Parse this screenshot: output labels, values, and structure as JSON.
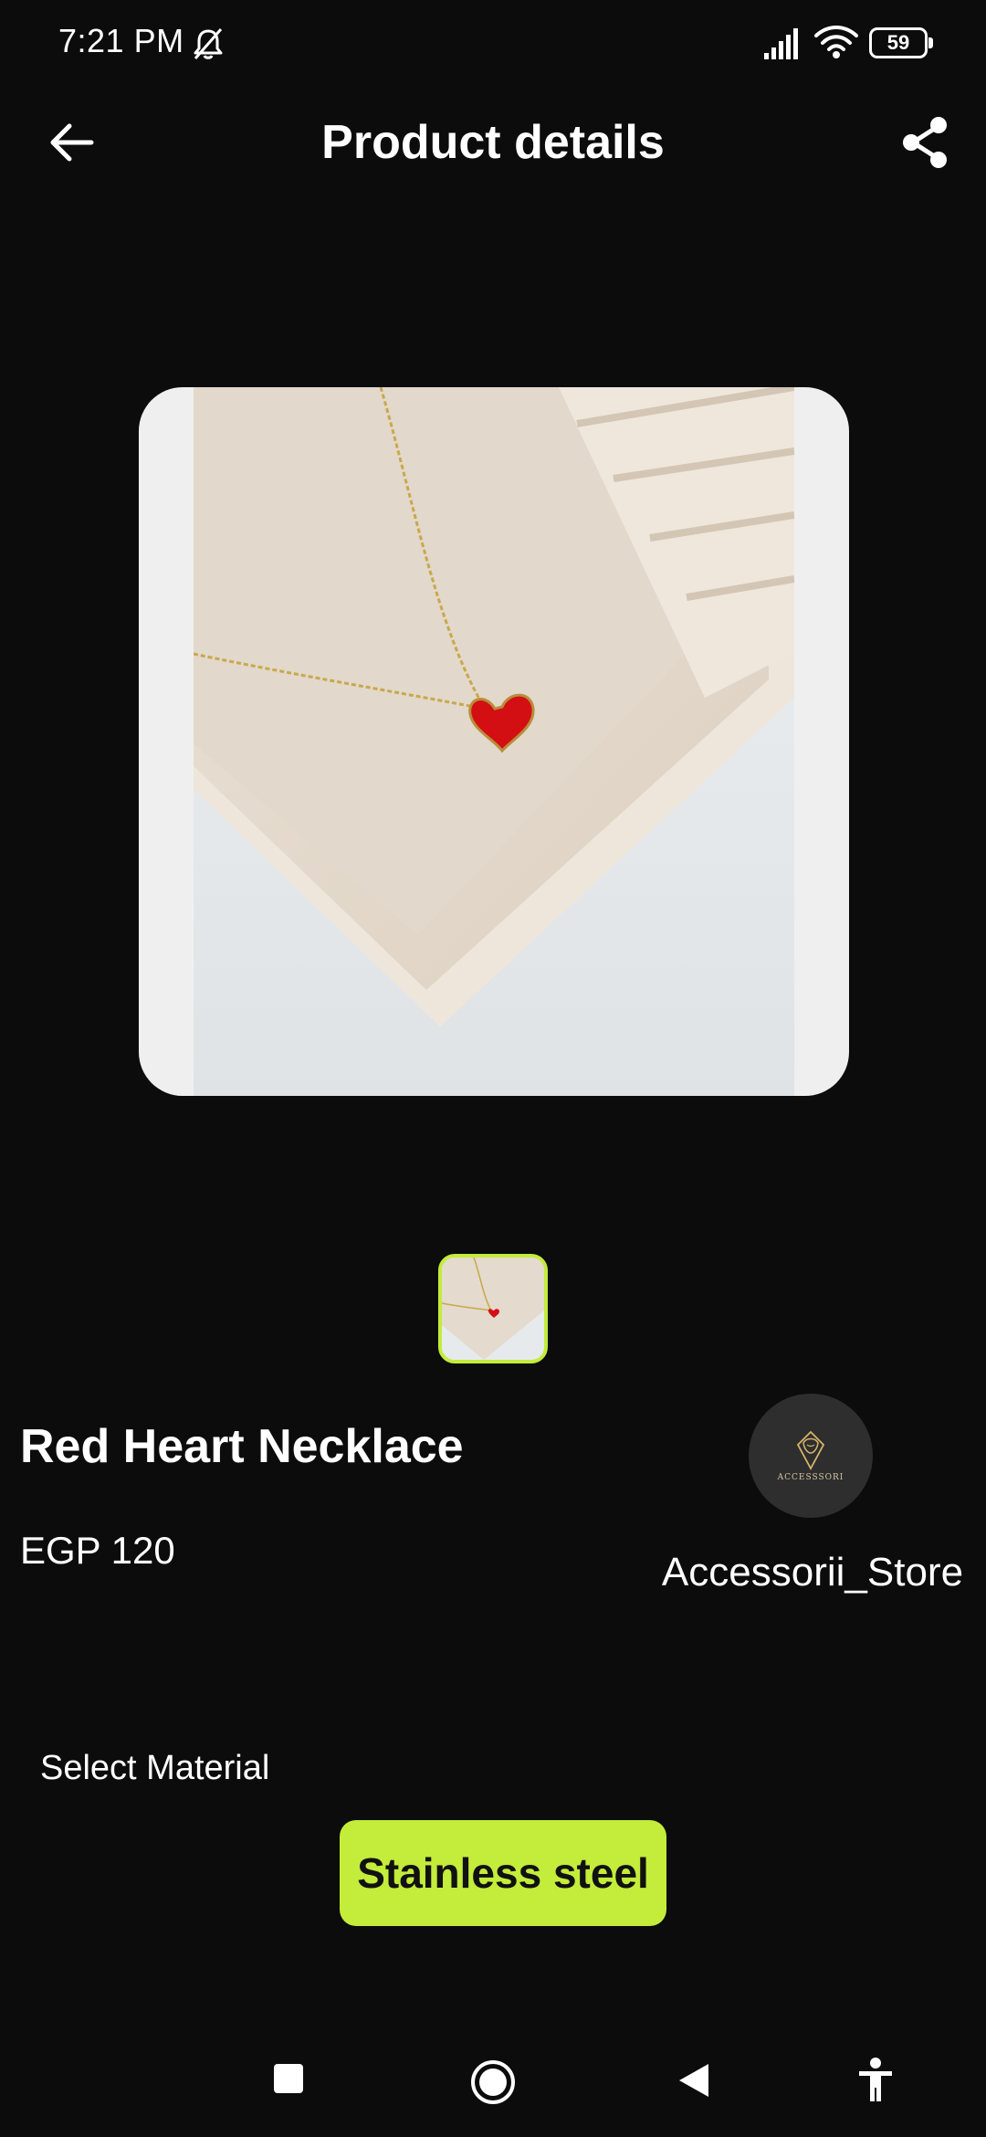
{
  "status_bar": {
    "time": "7:21 PM",
    "battery": "59",
    "icons": [
      "bell-off-icon",
      "signal-icon",
      "wifi-icon",
      "battery-icon"
    ]
  },
  "header": {
    "title": "Product details",
    "back_icon": "arrow-left-icon",
    "share_icon": "share-icon"
  },
  "product": {
    "name": "Red Heart Necklace",
    "price": "EGP 120",
    "image": "red-heart-necklace-photo",
    "thumbnails": [
      "red-heart-necklace-thumbnail"
    ]
  },
  "store": {
    "name": "Accessorii_Store",
    "logo_text": "ACCESSSORI"
  },
  "material": {
    "label": "Select Material",
    "options": [
      "Stainless steel"
    ],
    "selected": "Stainless steel"
  },
  "colors": {
    "background": "#0c0c0c",
    "accent": "#c3ec3b",
    "text": "#ffffff"
  },
  "nav_bar": [
    "recents-square-icon",
    "home-circle-icon",
    "back-triangle-icon",
    "accessibility-icon"
  ]
}
